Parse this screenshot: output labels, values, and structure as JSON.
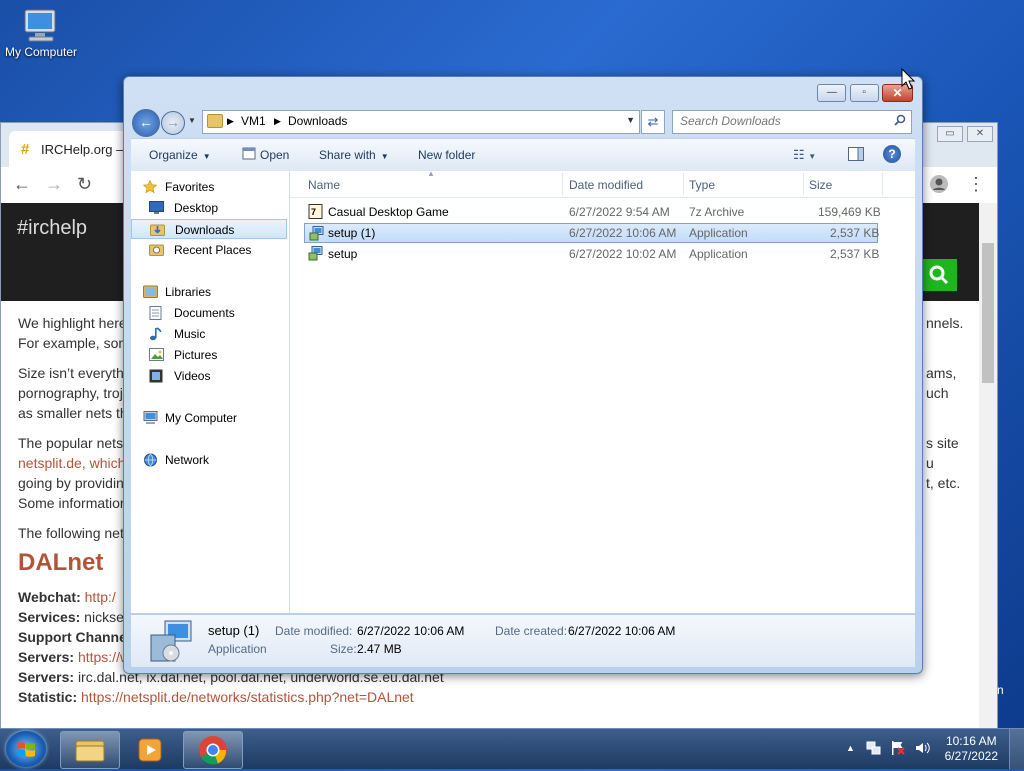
{
  "desktop": {
    "icon_label": "My Computer"
  },
  "browser": {
    "tab_title": "IRCHelp.org —",
    "site_brand": "#irchelp",
    "paragraphs": [
      "We highlight here",
      "For example, som",
      "Size isn’t everyth",
      "pornography, troj",
      "as smaller nets th",
      "The popular nets",
      "netsplit.de, which",
      "going by providin",
      "Some informatior",
      "The following net"
    ],
    "right_fragments": [
      "nnels.",
      "ams,",
      "uch",
      "s site",
      "u",
      "t, etc."
    ],
    "section_heading": "DALnet",
    "fields": [
      {
        "label": "Webchat:",
        "value": "http:/"
      },
      {
        "label": "Services:",
        "value": "nickse"
      },
      {
        "label": "Support Channe",
        "value": ""
      },
      {
        "label": "Servers:",
        "value": "https://www.dal.net/servers/"
      },
      {
        "label": "Servers:",
        "value": "irc.dal.net, ix.dal.net, pool.dal.net, underworld.se.eu.dal.net"
      },
      {
        "label": "Statistic:",
        "value": "https://netsplit.de/networks/statistics.php?net=DALnet"
      }
    ],
    "edge_char": "n"
  },
  "explorer": {
    "caption_buttons": {
      "minimize": "—",
      "maximize": "▫",
      "close": "✕"
    },
    "address": {
      "crumbs": [
        "VM1",
        "Downloads"
      ]
    },
    "search": {
      "placeholder": "Search Downloads"
    },
    "toolbar": {
      "organize": "Organize",
      "open": "Open",
      "share_with": "Share with",
      "new_folder": "New folder"
    },
    "nav": {
      "favorites_header": "Favorites",
      "favorites": [
        "Desktop",
        "Downloads",
        "Recent Places"
      ],
      "libraries_header": "Libraries",
      "libraries": [
        "Documents",
        "Music",
        "Pictures",
        "Videos"
      ],
      "computer": "My Computer",
      "network": "Network"
    },
    "columns": {
      "name": "Name",
      "date": "Date modified",
      "type": "Type",
      "size": "Size"
    },
    "files": [
      {
        "name": "Casual Desktop Game",
        "date": "6/27/2022 9:54 AM",
        "type": "7z Archive",
        "size": "159,469 KB"
      },
      {
        "name": "setup (1)",
        "date": "6/27/2022 10:06 AM",
        "type": "Application",
        "size": "2,537 KB"
      },
      {
        "name": "setup",
        "date": "6/27/2022 10:02 AM",
        "type": "Application",
        "size": "2,537 KB"
      }
    ],
    "details": {
      "name": "setup (1)",
      "kind": "Application",
      "modified_label": "Date modified:",
      "modified_value": "6/27/2022 10:06 AM",
      "created_label": "Date created:",
      "created_value": "6/27/2022 10:06 AM",
      "size_label": "Size:",
      "size_value": "2.47 MB"
    }
  },
  "taskbar": {
    "clock_time": "10:16 AM",
    "clock_date": "6/27/2022"
  },
  "colors": {
    "accent_link": "#b2543a",
    "selection": "#c1dcfa",
    "taskbar": "#1d3a63",
    "site_search_button": "#1fb51f"
  }
}
